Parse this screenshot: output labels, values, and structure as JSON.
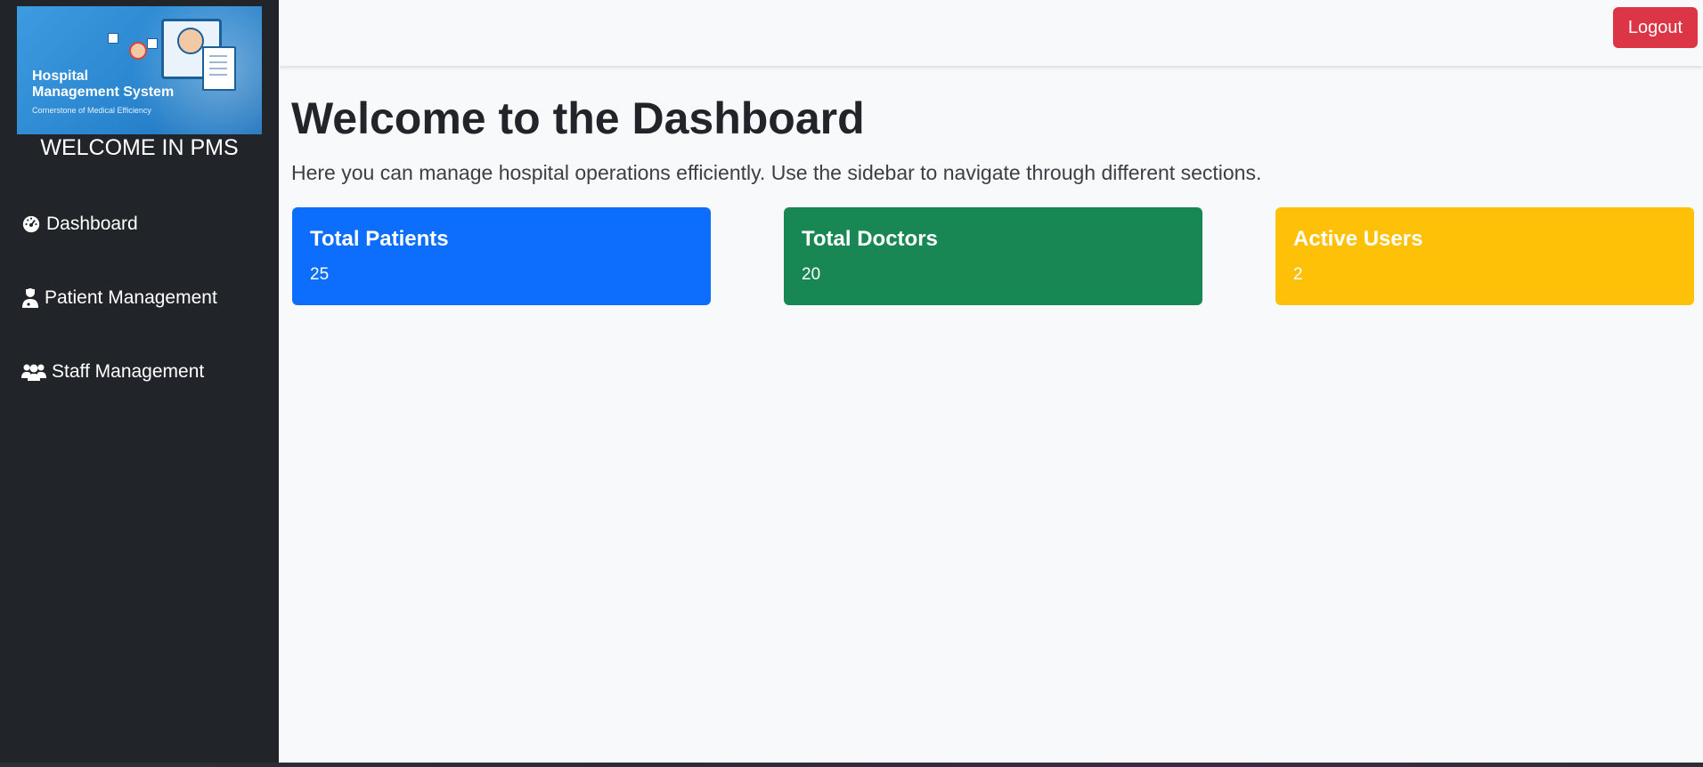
{
  "sidebar": {
    "logo": {
      "title_line1": "Hospital",
      "title_line2": "Management System",
      "tagline": "Cornerstone of Medical Efficiency"
    },
    "welcome": "WELCOME IN PMS",
    "items": [
      {
        "label": "Dashboard",
        "icon": "gauge-icon"
      },
      {
        "label": "Patient Management",
        "icon": "user-doctor-icon"
      },
      {
        "label": "Staff Management",
        "icon": "users-icon"
      }
    ]
  },
  "header": {
    "logout_label": "Logout"
  },
  "main": {
    "title": "Welcome to the Dashboard",
    "subtitle": "Here you can manage hospital operations efficiently. Use the sidebar to navigate through different sections.",
    "cards": [
      {
        "title": "Total Patients",
        "value": "25",
        "color": "#0d6efd"
      },
      {
        "title": "Total Doctors",
        "value": "20",
        "color": "#198754"
      },
      {
        "title": "Active Users",
        "value": "2",
        "color": "#ffc107"
      }
    ]
  },
  "colors": {
    "sidebar_bg": "#212529",
    "logout_bg": "#dc3545",
    "page_bg": "#f8f9fa"
  }
}
